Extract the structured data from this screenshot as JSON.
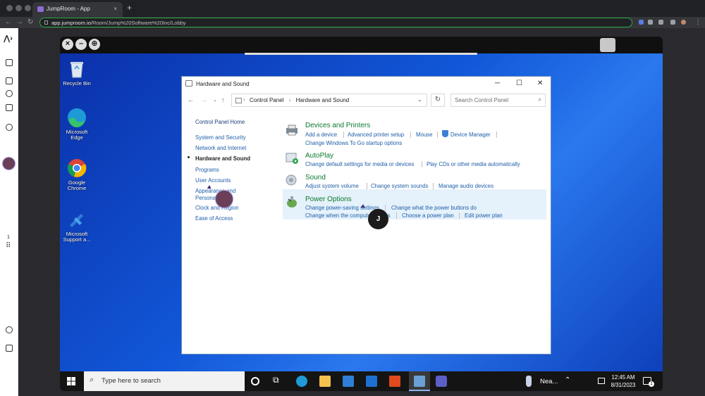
{
  "browser": {
    "tab_title": "JumpRoom - App",
    "tab_close": "×",
    "new_tab": "+",
    "url_domain": "app.jumproom.io",
    "url_path": "/Room/Jump%20Software%20Inc/Lobby"
  },
  "rail": {
    "people_count": "1"
  },
  "vm": {
    "close_btn": "×",
    "min_btn": "–",
    "fit_btn": "⊕"
  },
  "desktop": {
    "icons": [
      {
        "label": "Recycle Bin"
      },
      {
        "label": "Microsoft Edge"
      },
      {
        "label": "Google Chrome"
      },
      {
        "label": "Microsoft Support a..."
      }
    ]
  },
  "window": {
    "title": "Hardware and Sound",
    "breadcrumb": [
      "Control Panel",
      "Hardware and Sound"
    ],
    "search_placeholder": "Search Control Panel",
    "sidebar": [
      {
        "label": "Control Panel Home"
      },
      {
        "label": "System and Security"
      },
      {
        "label": "Network and Internet"
      },
      {
        "label": "Hardware and Sound"
      },
      {
        "label": "Programs"
      },
      {
        "label": "User Accounts"
      },
      {
        "label": "Appearance and Personalization"
      },
      {
        "label": "Clock and Region"
      },
      {
        "label": "Ease of Access"
      }
    ],
    "sections": [
      {
        "title": "Devices and Printers",
        "row1": [
          "Add a device",
          "Advanced printer setup",
          "Mouse",
          "Device Manager"
        ],
        "row2": [
          "Change Windows To Go startup options"
        ]
      },
      {
        "title": "AutoPlay",
        "row1": [
          "Change default settings for media or devices",
          "Play CDs or other media automatically"
        ]
      },
      {
        "title": "Sound",
        "row1": [
          "Adjust system volume",
          "Change system sounds",
          "Manage audio devices"
        ]
      },
      {
        "title": "Power Options",
        "row1": [
          "Change power-saving settings",
          "Change what the power buttons do"
        ],
        "row2": [
          "Change when the computer sleeps",
          "Choose a power plan",
          "Edit power plan"
        ]
      }
    ]
  },
  "taskbar": {
    "search_placeholder": "Type here to search",
    "weather": "Nea...",
    "time": "12:45 AM",
    "date": "8/31/2023",
    "notif_count": "1"
  },
  "overlay": {
    "badge_letter": "J"
  },
  "colors": {
    "link": "#1e5ea8",
    "section_title": "#0a7a2e",
    "omnibox_border": "#2ca843",
    "desktop_bg": "#1157d8"
  }
}
